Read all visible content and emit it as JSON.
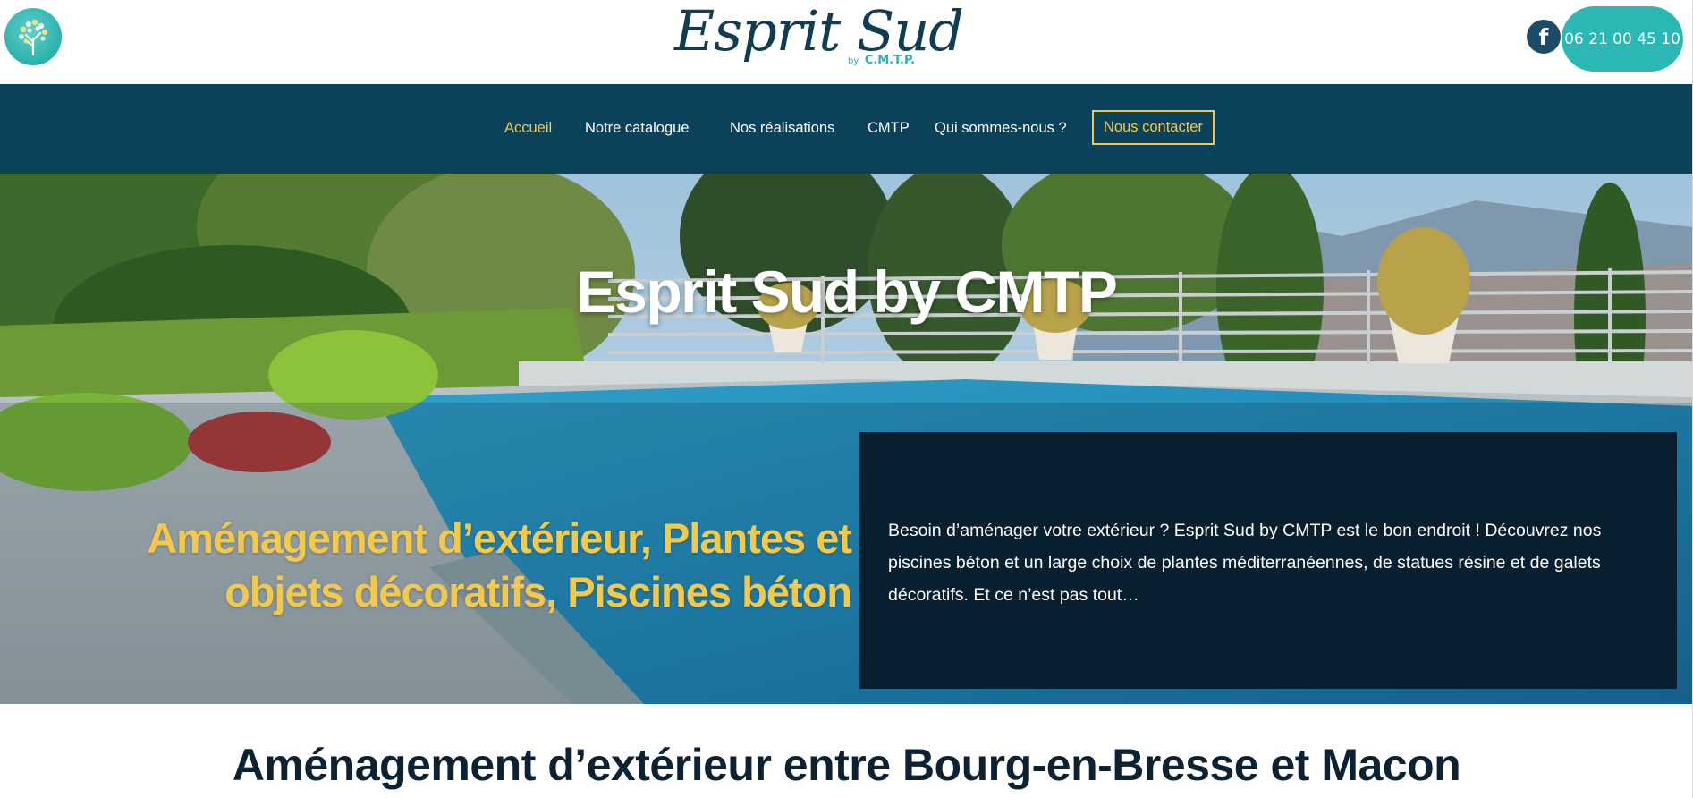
{
  "header": {
    "brand_name": "Esprit Sud",
    "brand_by": "by",
    "brand_company": "C.M.T.P.",
    "facebook_label": "f",
    "phone": "06 21 00 45 10"
  },
  "nav": {
    "items": [
      {
        "label": "Accueil",
        "active": true
      },
      {
        "label": "Notre catalogue",
        "active": false
      },
      {
        "label": "Nos réalisations",
        "active": false
      },
      {
        "label": "CMTP",
        "active": false
      },
      {
        "label": "Qui sommes-nous ?",
        "active": false
      }
    ],
    "cta_label": "Nous contacter"
  },
  "hero": {
    "title": "Esprit Sud by CMTP",
    "subtitle_line1": "Aménagement d’extérieur, Plantes et",
    "subtitle_line2": "objets décoratifs, Piscines béton",
    "description": "Besoin d’aménager votre extérieur ? Esprit Sud by CMTP est le bon endroit ! Découvrez nos piscines béton et un large choix de plantes méditerranéennes, de statues résine et de galets décoratifs. Et ce n’est pas tout…"
  },
  "section": {
    "title": "Aménagement d’extérieur entre Bourg-en-Bresse et Macon"
  },
  "colors": {
    "nav_bg": "#0c4259",
    "accent_yellow": "#f2c94c",
    "turquoise": "#2bb8b4",
    "dark_box": "#071f2e",
    "text_dark": "#0c2233"
  },
  "icons": [
    "tree-logo-icon",
    "facebook-icon"
  ]
}
